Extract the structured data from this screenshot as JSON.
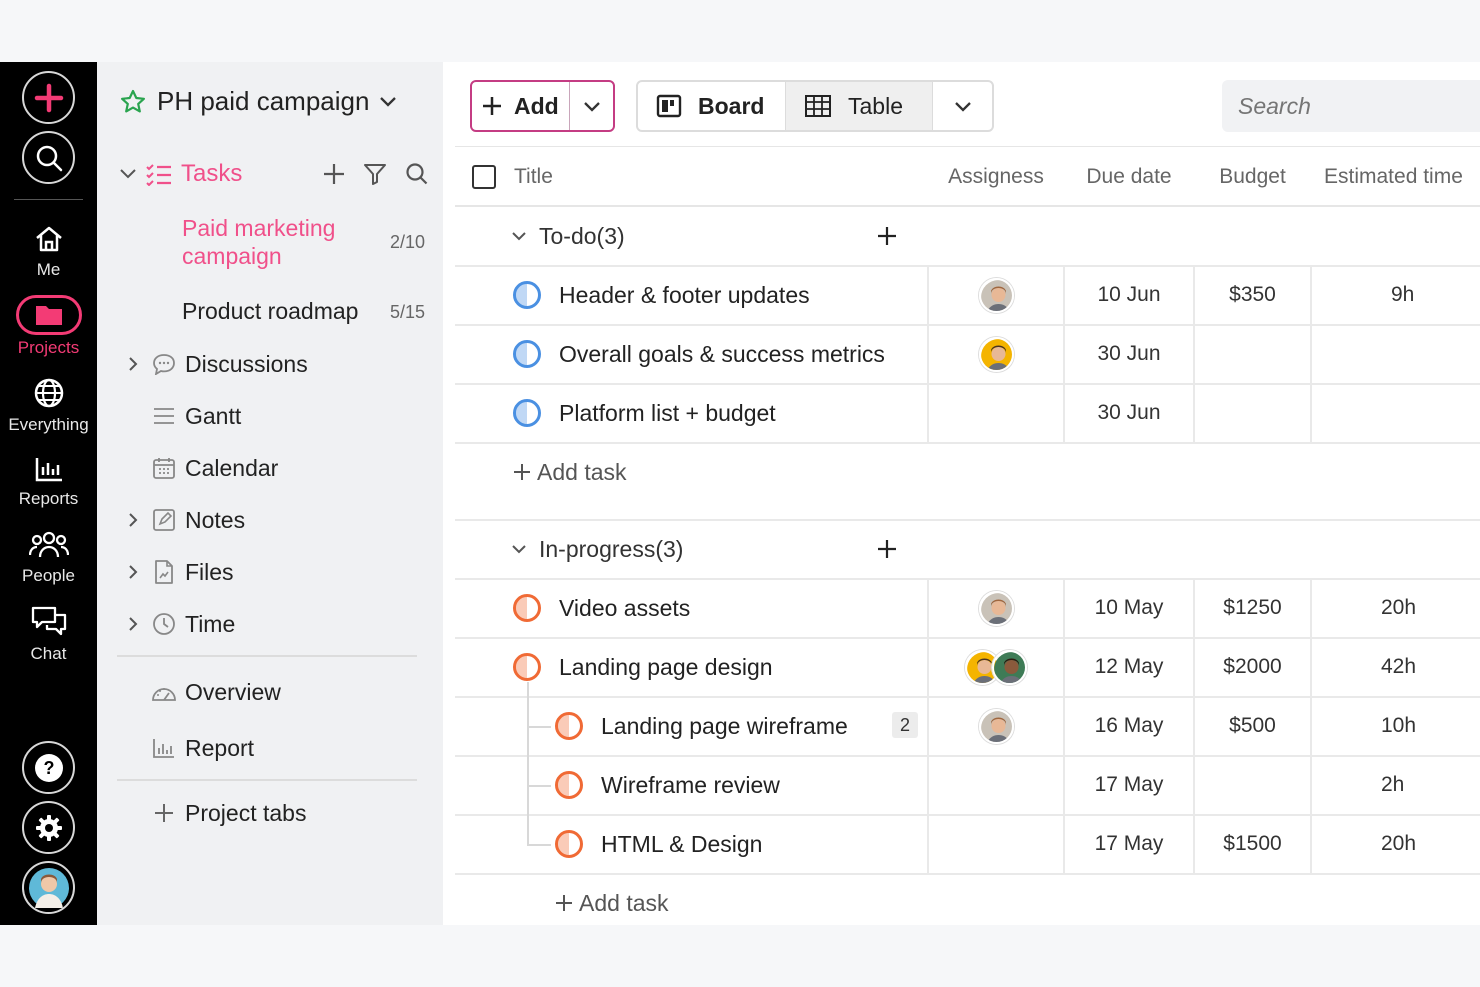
{
  "rail": {
    "items": [
      {
        "label": "Me"
      },
      {
        "label": "Projects"
      },
      {
        "label": "Everything"
      },
      {
        "label": "Reports"
      },
      {
        "label": "People"
      },
      {
        "label": "Chat"
      }
    ]
  },
  "sidebar": {
    "project_title": "PH paid campaign",
    "tasks_label": "Tasks",
    "subprojects": [
      {
        "line1": "Paid marketing",
        "line2": "campaign",
        "count": "2/10"
      },
      {
        "label": "Product roadmap",
        "count": "5/15"
      }
    ],
    "nav": [
      {
        "label": "Discussions"
      },
      {
        "label": "Gantt"
      },
      {
        "label": "Calendar"
      },
      {
        "label": "Notes"
      },
      {
        "label": "Files"
      },
      {
        "label": "Time"
      },
      {
        "label": "Overview"
      },
      {
        "label": "Report"
      }
    ],
    "project_tabs": "Project tabs"
  },
  "toolbar": {
    "add_label": "Add",
    "board_label": "Board",
    "table_label": "Table",
    "search_placeholder": "Search"
  },
  "table": {
    "columns": [
      "Title",
      "Assigness",
      "Due date",
      "Budget",
      "Estimated time"
    ],
    "add_task": "Add task",
    "groups": [
      {
        "name": "To-do(3)",
        "color": "#4a90e2",
        "rows": [
          {
            "title": "Header & footer updates",
            "due": "10 Jun",
            "budget": "$350",
            "estimate": "9h"
          },
          {
            "title": "Overall goals & success metrics",
            "due": "30 Jun",
            "budget": "",
            "estimate": ""
          },
          {
            "title": "Platform list + budget",
            "due": "30 Jun",
            "budget": "",
            "estimate": ""
          }
        ]
      },
      {
        "name": "In-progress(3)",
        "color": "#f06a35",
        "rows": [
          {
            "title": "Video assets",
            "due": "10 May",
            "budget": "$1250",
            "estimate": "20h"
          },
          {
            "title": "Landing page design",
            "due": "12 May",
            "budget": "$2000",
            "estimate": "42h"
          },
          {
            "title": "Landing page wireframe",
            "due": "16 May",
            "budget": "$500",
            "estimate": "10h",
            "badge": "2"
          },
          {
            "title": "Wireframe review",
            "due": "17 May",
            "budget": "",
            "estimate": "2h"
          },
          {
            "title": "HTML & Design",
            "due": "17 May",
            "budget": "$1500",
            "estimate": "20h"
          }
        ]
      }
    ]
  },
  "colors": {
    "accent_pink": "#f33b75",
    "todo_blue": "#4a90e2",
    "progress_orange": "#f06a35",
    "add_border": "#c43c83"
  }
}
